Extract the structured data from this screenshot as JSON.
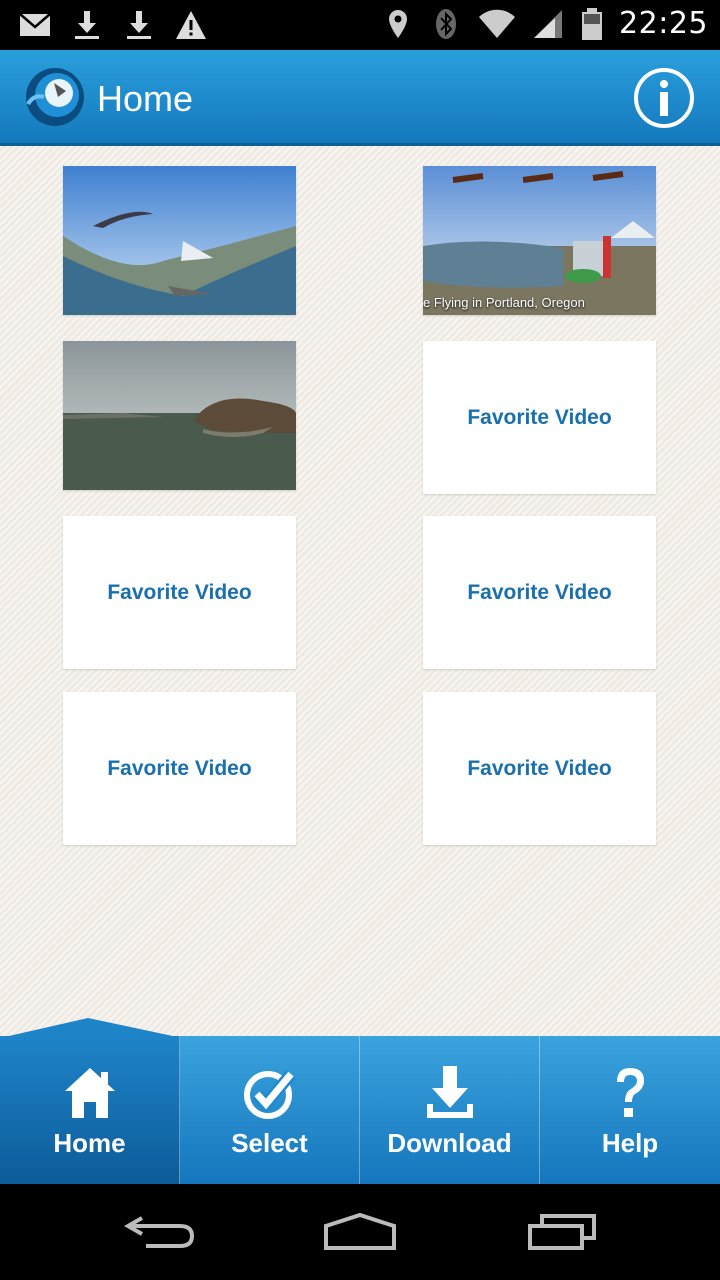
{
  "status_bar": {
    "time": "22:25",
    "left_icons": [
      "mail-icon",
      "download-icon",
      "download-icon",
      "warning-icon"
    ],
    "right_icons": [
      "location-icon",
      "bluetooth-icon",
      "wifi-icon",
      "signal-icon",
      "battery-icon"
    ]
  },
  "app_bar": {
    "title": "Home",
    "logo_icon": "app-logo-icon",
    "info_icon": "info-icon",
    "accent": "#1e8ad0"
  },
  "grid": {
    "tiles": [
      {
        "kind": "thumbnail",
        "subject": "hang-glider panorama",
        "caption": ""
      },
      {
        "kind": "thumbnail",
        "subject": "waterfront panorama",
        "caption": "e Flying in Portland, Oregon"
      },
      {
        "kind": "thumbnail",
        "subject": "lake panorama",
        "caption": ""
      },
      {
        "kind": "placeholder",
        "label": "Favorite Video"
      },
      {
        "kind": "placeholder",
        "label": "Favorite Video"
      },
      {
        "kind": "placeholder",
        "label": "Favorite Video"
      },
      {
        "kind": "placeholder",
        "label": "Favorite Video"
      },
      {
        "kind": "placeholder",
        "label": "Favorite Video"
      }
    ],
    "label_color": "#1a6fae"
  },
  "bottom_nav": {
    "items": [
      {
        "label": "Home",
        "icon": "home-icon",
        "active": true
      },
      {
        "label": "Select",
        "icon": "check-circle-icon",
        "active": false
      },
      {
        "label": "Download",
        "icon": "download-icon",
        "active": false
      },
      {
        "label": "Help",
        "icon": "question-icon",
        "active": false
      }
    ]
  },
  "system_nav": {
    "icons": [
      "back-icon",
      "home-outline-icon",
      "recents-icon"
    ]
  }
}
